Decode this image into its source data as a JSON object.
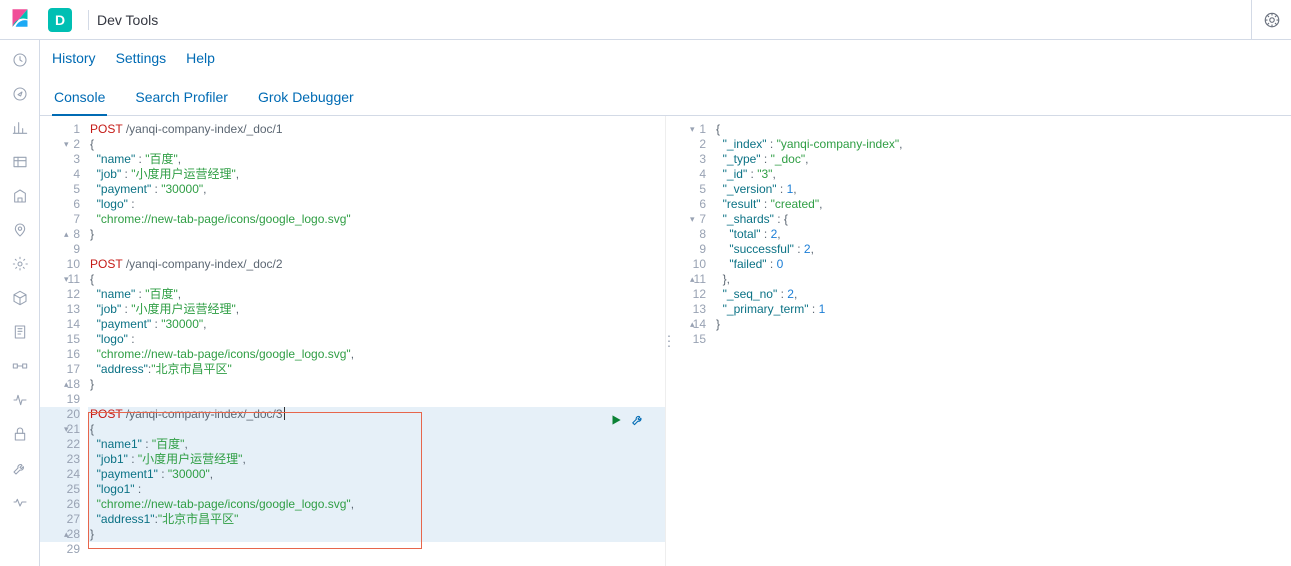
{
  "header": {
    "app_letter": "D",
    "app_title": "Dev Tools"
  },
  "sub_links": [
    "History",
    "Settings",
    "Help"
  ],
  "tabs": [
    "Console",
    "Search Profiler",
    "Grok Debugger"
  ],
  "active_tab": 0,
  "side_icons": [
    "clock-icon",
    "compass-icon",
    "bar-chart-icon",
    "table-icon",
    "building-icon",
    "pin-icon",
    "gear-ml-icon",
    "cube-icon",
    "notebook-icon",
    "pipeline-icon",
    "pulse-icon",
    "lock-icon",
    "wrench-icon",
    "heart-icon"
  ],
  "request_editor": {
    "lines": [
      {
        "n": 1,
        "method": "POST",
        "url": "/yanqi-company-index/_doc/1"
      },
      {
        "n": 2,
        "text": "{",
        "fold": "d"
      },
      {
        "n": 3,
        "indent": "  ",
        "key": "name",
        "val": "百度",
        "comma": true
      },
      {
        "n": 4,
        "indent": "  ",
        "key": "job",
        "val": "小度用户运营经理",
        "comma": true
      },
      {
        "n": 5,
        "indent": "  ",
        "key": "payment",
        "val": "30000",
        "comma": true
      },
      {
        "n": 6,
        "indent": "  ",
        "key": "logo",
        "raw": " :"
      },
      {
        "n": 7,
        "indent": "  ",
        "str": "chrome://new-tab-page/icons/google_logo.svg"
      },
      {
        "n": 8,
        "text": "}",
        "fold": "u"
      },
      {
        "n": 9,
        "text": ""
      },
      {
        "n": 10,
        "method": "POST",
        "url": "/yanqi-company-index/_doc/2"
      },
      {
        "n": 11,
        "text": "{",
        "fold": "d"
      },
      {
        "n": 12,
        "indent": "  ",
        "key": "name",
        "val": "百度",
        "comma": true
      },
      {
        "n": 13,
        "indent": "  ",
        "key": "job",
        "val": "小度用户运营经理",
        "comma": true
      },
      {
        "n": 14,
        "indent": "  ",
        "key": "payment",
        "val": "30000",
        "comma": true
      },
      {
        "n": 15,
        "indent": "  ",
        "key": "logo",
        "raw": " :"
      },
      {
        "n": 16,
        "indent": "  ",
        "str": "chrome://new-tab-page/icons/google_logo.svg",
        "comma": true
      },
      {
        "n": 17,
        "indent": "  ",
        "key": "address",
        "val": "北京市昌平区",
        "nospace": true
      },
      {
        "n": 18,
        "text": "}",
        "fold": "u"
      },
      {
        "n": 19,
        "text": ""
      },
      {
        "n": 20,
        "method": "POST",
        "url": "/yanqi-company-index/_doc/3",
        "hl": true,
        "cursor": true
      },
      {
        "n": 21,
        "text": "{",
        "fold": "d",
        "hl": true
      },
      {
        "n": 22,
        "indent": "  ",
        "key": "name1",
        "val": "百度",
        "comma": true,
        "hl": true
      },
      {
        "n": 23,
        "indent": "  ",
        "key": "job1",
        "val": "小度用户运营经理",
        "comma": true,
        "hl": true
      },
      {
        "n": 24,
        "indent": "  ",
        "key": "payment1",
        "val": "30000",
        "comma": true,
        "hl": true
      },
      {
        "n": 25,
        "indent": "  ",
        "key": "logo1",
        "raw": " :",
        "hl": true
      },
      {
        "n": 26,
        "indent": "  ",
        "str": "chrome://new-tab-page/icons/google_logo.svg",
        "comma": true,
        "hl": true
      },
      {
        "n": 27,
        "indent": "  ",
        "key": "address1",
        "val": "北京市昌平区",
        "nospace": true,
        "hl": true
      },
      {
        "n": 28,
        "text": "}",
        "fold": "u",
        "hl": true
      },
      {
        "n": 29,
        "text": ""
      }
    ],
    "red_box": {
      "from": 20,
      "to": 28
    },
    "run_at_line": 20
  },
  "response_editor": {
    "lines": [
      {
        "n": 1,
        "text": "{",
        "fold": "d"
      },
      {
        "n": 2,
        "indent": "  ",
        "key": "_index",
        "val": "yanqi-company-index",
        "comma": true
      },
      {
        "n": 3,
        "indent": "  ",
        "key": "_type",
        "val": "_doc",
        "comma": true
      },
      {
        "n": 4,
        "indent": "  ",
        "key": "_id",
        "val": "3",
        "comma": true
      },
      {
        "n": 5,
        "indent": "  ",
        "key": "_version",
        "num": 1,
        "comma": true
      },
      {
        "n": 6,
        "indent": "  ",
        "key": "result",
        "val": "created",
        "comma": true
      },
      {
        "n": 7,
        "indent": "  ",
        "key": "_shards",
        "objopen": true,
        "fold": "d"
      },
      {
        "n": 8,
        "indent": "    ",
        "key": "total",
        "num": 2,
        "comma": true
      },
      {
        "n": 9,
        "indent": "    ",
        "key": "successful",
        "num": 2,
        "comma": true
      },
      {
        "n": 10,
        "indent": "    ",
        "key": "failed",
        "num": 0
      },
      {
        "n": 11,
        "indent": "  ",
        "text": "},",
        "fold": "u"
      },
      {
        "n": 12,
        "indent": "  ",
        "key": "_seq_no",
        "num": 2,
        "comma": true
      },
      {
        "n": 13,
        "indent": "  ",
        "key": "_primary_term",
        "num": 1
      },
      {
        "n": 14,
        "text": "}",
        "fold": "u"
      },
      {
        "n": 15,
        "text": ""
      }
    ]
  }
}
